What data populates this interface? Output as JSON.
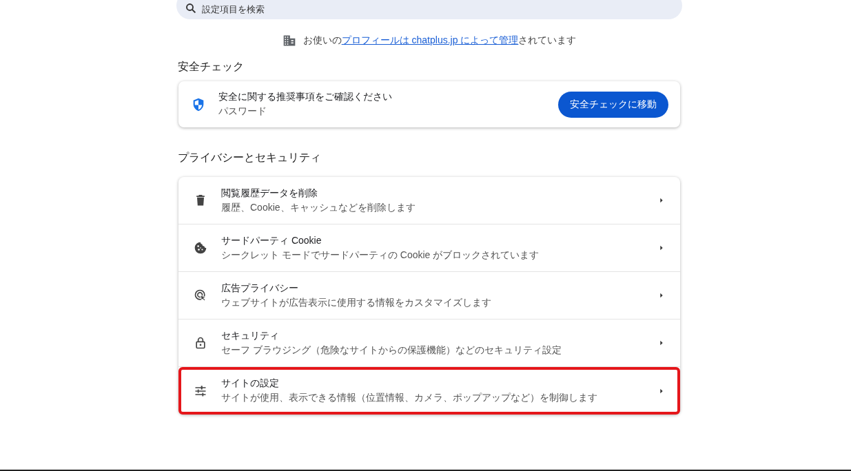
{
  "search": {
    "placeholder": "設定項目を検索"
  },
  "managed_notice": {
    "prefix": "お使いの",
    "link": "プロフィールは chatplus.jp によって管理",
    "suffix": "されています"
  },
  "safety_check": {
    "heading": "安全チェック",
    "title": "安全に関する推奨事項をご確認ください",
    "subtitle": "パスワード",
    "button": "安全チェックに移動"
  },
  "privacy": {
    "heading": "プライバシーとセキュリティ",
    "rows": [
      {
        "kind": "trash",
        "title": "閲覧履歴データを削除",
        "subtitle": "履歴、Cookie、キャッシュなどを削除します",
        "highlighted": false
      },
      {
        "kind": "cookie",
        "title": "サードパーティ Cookie",
        "subtitle": "シークレット モードでサードパーティの Cookie がブロックされています",
        "highlighted": false
      },
      {
        "kind": "ads",
        "title": "広告プライバシー",
        "subtitle": "ウェブサイトが広告表示に使用する情報をカスタマイズします",
        "highlighted": false
      },
      {
        "kind": "lock",
        "title": "セキュリティ",
        "subtitle": "セーフ ブラウジング（危険なサイトからの保護機能）などのセキュリティ設定",
        "highlighted": false
      },
      {
        "kind": "sliders",
        "title": "サイトの設定",
        "subtitle": "サイトが使用、表示できる情報（位置情報、カメラ、ポップアップなど）を制御します",
        "highlighted": true
      }
    ]
  }
}
